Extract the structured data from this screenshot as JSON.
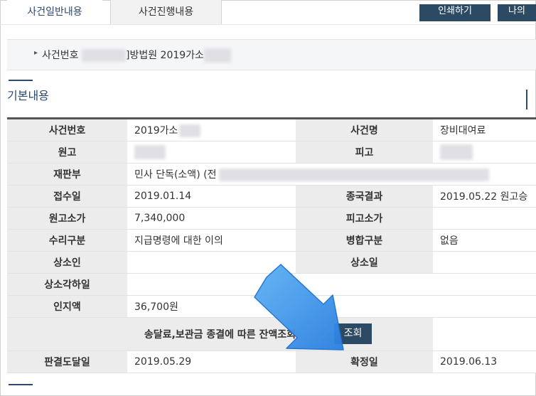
{
  "tabs": [
    {
      "label": "사건일반내용",
      "active": true
    },
    {
      "label": "사건진행내용",
      "active": false
    }
  ],
  "buttons": {
    "print_label": "인쇄하기",
    "other_label": "나의"
  },
  "case_header": {
    "prefix": "사건번호",
    "suffix": "]방법원 2019가소"
  },
  "section": {
    "title": "기본내용"
  },
  "details": {
    "case_number_label": "사건번호",
    "case_number_value": "2019가소",
    "case_name_label": "사건명",
    "case_name_value": "장비대여료",
    "plaintiff_label": "원고",
    "defendant_label": "피고",
    "court_division_label": "재판부",
    "court_division_value": "민사 단독(소액) (전",
    "received_date_label": "접수일",
    "received_date_value": "2019.01.14",
    "final_result_label": "종국결과",
    "final_result_value": "2019.05.22 원고승",
    "plaintiff_claim_label": "원고소가",
    "plaintiff_claim_value": "7,340,000",
    "defendant_claim_label": "피고소가",
    "acceptance_type_label": "수리구분",
    "acceptance_type_value": "지급명령에 대한 이의",
    "merge_type_label": "병합구분",
    "merge_type_value": "없음",
    "appellant_label": "상소인",
    "appeal_date_label": "상소일",
    "appeal_dismissal_date_label": "상소각하일",
    "stamp_fee_label": "인지액",
    "stamp_fee_value": "36,700원",
    "balance_inquiry_label": "송달료,보관금 종결에 따른 잔액조회",
    "inquiry_button_label": "조회",
    "judgment_delivery_label": "판결도달일",
    "judgment_delivery_value": "2019.05.29",
    "finalized_date_label": "확정일",
    "finalized_date_value": "2019.06.13"
  },
  "colors": {
    "accent": "#2c4a70",
    "button_dark": "#2c4a63",
    "header_cell": "#ececec",
    "arrow": "#3a8ee6"
  }
}
